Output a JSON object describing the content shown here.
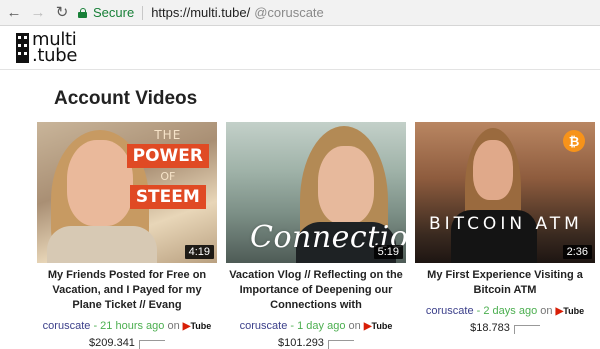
{
  "browser": {
    "secure_label": "Secure",
    "url_host": "https://multi.tube/",
    "url_path": "@coruscate",
    "back_icon": "arrow-left-icon",
    "forward_icon": "arrow-right-icon",
    "reload_icon": "reload-icon"
  },
  "site": {
    "logo_top": "multi",
    "logo_bottom": ".tube"
  },
  "page": {
    "title": "Account Videos"
  },
  "videos": [
    {
      "title": "My Friends Posted for Free on Vacation, and I Payed for my Plane Ticket // Evang",
      "duration": "4:19",
      "author": "coruscate",
      "time": "21 hours ago",
      "on": "on",
      "platform": "Tube",
      "payout": "$209.341",
      "overlay": {
        "the": "THE",
        "word1": "POWER",
        "of": "OF",
        "word2": "STEEM"
      }
    },
    {
      "title": "Vacation Vlog // Reflecting on the Importance of Deepening our Connections with",
      "duration": "5:19",
      "author": "coruscate",
      "time": "1 day ago",
      "on": "on",
      "platform": "Tube",
      "payout": "$101.293",
      "overlay": {
        "text": "Connection"
      }
    },
    {
      "title": "My First Experience Visiting a Bitcoin ATM",
      "duration": "2:36",
      "author": "coruscate",
      "time": "2 days ago",
      "on": "on",
      "platform": "Tube",
      "payout": "$18.783",
      "overlay": {
        "text": "BITCOIN ATM",
        "coin": "₿"
      }
    }
  ],
  "colors": {
    "secure_green": "#188038",
    "time_green": "#4caf50",
    "author_blue": "#3b3f8a",
    "dtube_red": "#d81e06"
  }
}
